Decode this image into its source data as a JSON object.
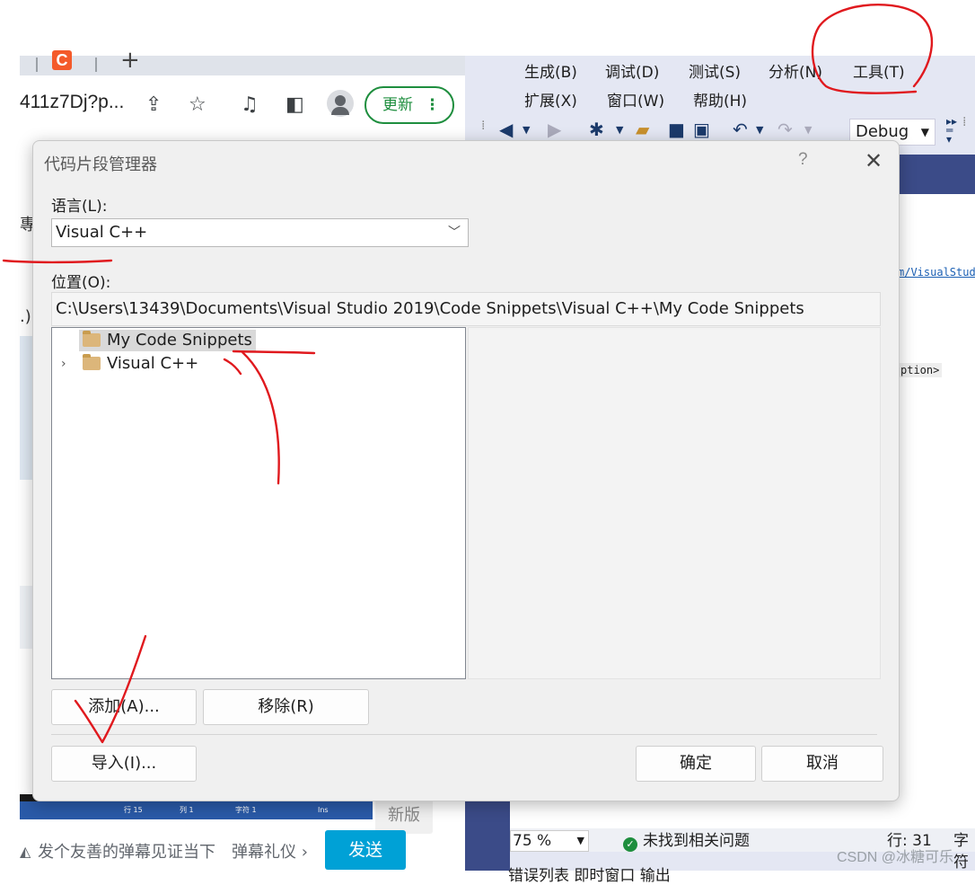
{
  "browser": {
    "tab_favicon_letter": "C",
    "new_tab_symbol": "+",
    "url_fragment": "411z7Dj?p...",
    "update_button": "更新",
    "update_menu": "⋮",
    "page_fragment_1": "專",
    "page_fragment_2": ".)",
    "status_row": "行 15",
    "status_col": "列 1",
    "status_char": "字符 1",
    "status_ins": "Ins",
    "new_version": "新版",
    "danmu_placeholder": "发个友善的弹幕见证当下",
    "danmu_etiquette": "弹幕礼仪 ›",
    "send_button": "发送"
  },
  "vs": {
    "menu": [
      "生成(B)",
      "调试(D)",
      "测试(S)",
      "分析(N)",
      "工具(T)",
      "扩展(X)",
      "窗口(W)",
      "帮助(H)"
    ],
    "config": "Debug",
    "code_link": "m/VisualStud",
    "code_line": "ption>",
    "zoom": "75 %",
    "issues": "未找到相关问题",
    "row": "行: 31",
    "char_label": "字符",
    "bottom_tabs": "错误列表   即时窗口   输出"
  },
  "dialog": {
    "title": "代码片段管理器",
    "help": "?",
    "close": "✕",
    "language_label": "语言(L):",
    "language_value": "Visual C++",
    "location_label": "位置(O):",
    "location_value": "C:\\Users\\13439\\Documents\\Visual Studio 2019\\Code Snippets\\Visual C++\\My Code Snippets",
    "tree": [
      {
        "label": "My Code Snippets",
        "selected": true,
        "expandable": false
      },
      {
        "label": "Visual C++",
        "selected": false,
        "expandable": true
      }
    ],
    "buttons": {
      "add": "添加(A)...",
      "remove": "移除(R)",
      "import": "导入(I)...",
      "ok": "确定",
      "cancel": "取消"
    }
  },
  "watermark": "CSDN @冰糖可乐",
  "colors": {
    "annotation": "#e0191e",
    "vs_band": "#3b4b88",
    "update_green": "#1e8e3e",
    "send_blue": "#00a1d6"
  }
}
